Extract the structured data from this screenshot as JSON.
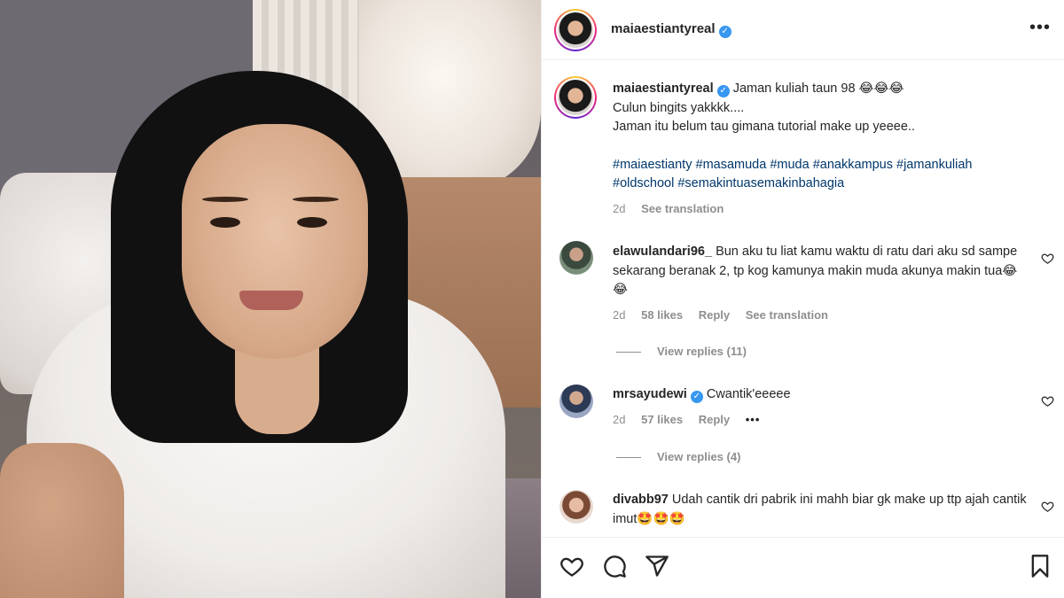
{
  "post": {
    "username": "maiaestiantyreal",
    "verified_mark": "✓",
    "more_label": "•••"
  },
  "caption": {
    "username": "maiaestiantyreal",
    "line1": "Jaman kuliah taun 98 😂😂😂",
    "line2": "Culun bingits yakkkk....",
    "line3": "Jaman itu belum tau gimana tutorial make up yeeee..",
    "hashtags_line1": [
      "#maiaestianty",
      "#masamuda",
      "#muda",
      "#anakkampus",
      "#jamankuliah"
    ],
    "hashtags_line2": [
      "#oldschool",
      "#semakintuasemakinbahagia"
    ],
    "time": "2d",
    "see_translation": "See translation"
  },
  "comments": [
    {
      "username": "elawulandari96_",
      "verified": false,
      "text": "Bun aku tu liat kamu waktu di ratu dari aku sd sampe sekarang beranak 2, tp kog kamunya makin muda akunya makin tua😂😂",
      "time": "2d",
      "likes": "58 likes",
      "reply": "Reply",
      "see_translation": "See translation",
      "view_replies": "View replies (11)"
    },
    {
      "username": "mrsayudewi",
      "verified": true,
      "text": "Cwantik'eeeee",
      "time": "2d",
      "likes": "57 likes",
      "reply": "Reply",
      "more": "•••",
      "view_replies": "View replies (4)"
    },
    {
      "username": "divabb97",
      "verified": false,
      "text": "Udah cantik dri pabrik ini mahh biar gk make up ttp ajah cantik imut🤩🤩🤩"
    }
  ],
  "icons": {
    "like": "heart-icon",
    "comment": "comment-icon",
    "share": "share-icon",
    "save": "bookmark-icon",
    "comment_like": "heart-icon"
  },
  "colors": {
    "hashtag": "#00376b",
    "verified": "#3897f0",
    "muted": "#8e8e8e"
  }
}
